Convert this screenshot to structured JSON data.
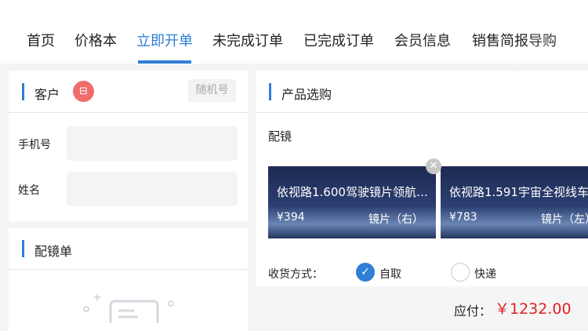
{
  "nav": {
    "tabs": [
      "首页",
      "价格本",
      "立即开单",
      "未完成订单",
      "已完成订单",
      "会员信息",
      "销售简报",
      "导购"
    ],
    "active": 2,
    "pull_icon": "refresh-arrow-icon"
  },
  "customer": {
    "title": "客户",
    "scan_icon": "scan-icon",
    "random_label": "随机号",
    "phone_label": "手机号",
    "name_label": "姓名",
    "phone_value": "",
    "name_value": ""
  },
  "prescription": {
    "title": "配镜单",
    "empty_icon": "empty-state-icon"
  },
  "products": {
    "title": "产品选购",
    "section": "配镜",
    "items": [
      {
        "name": "依视路1.600驾驶镜片领航…",
        "price": "¥394",
        "type": "镜片（右）"
      },
      {
        "name": "依视路1.591宇宙全视线车",
        "price": "¥783",
        "type": "镜片（左）"
      }
    ]
  },
  "delivery": {
    "label": "收货方式：",
    "options": [
      "自取",
      "快递"
    ],
    "selected": 0
  },
  "footer": {
    "payable_label": "应付：",
    "payable_amount": "￥1232.00"
  },
  "colors": {
    "accent": "#2f7fd6",
    "price": "#e02020",
    "scan": "#f06b6b"
  }
}
